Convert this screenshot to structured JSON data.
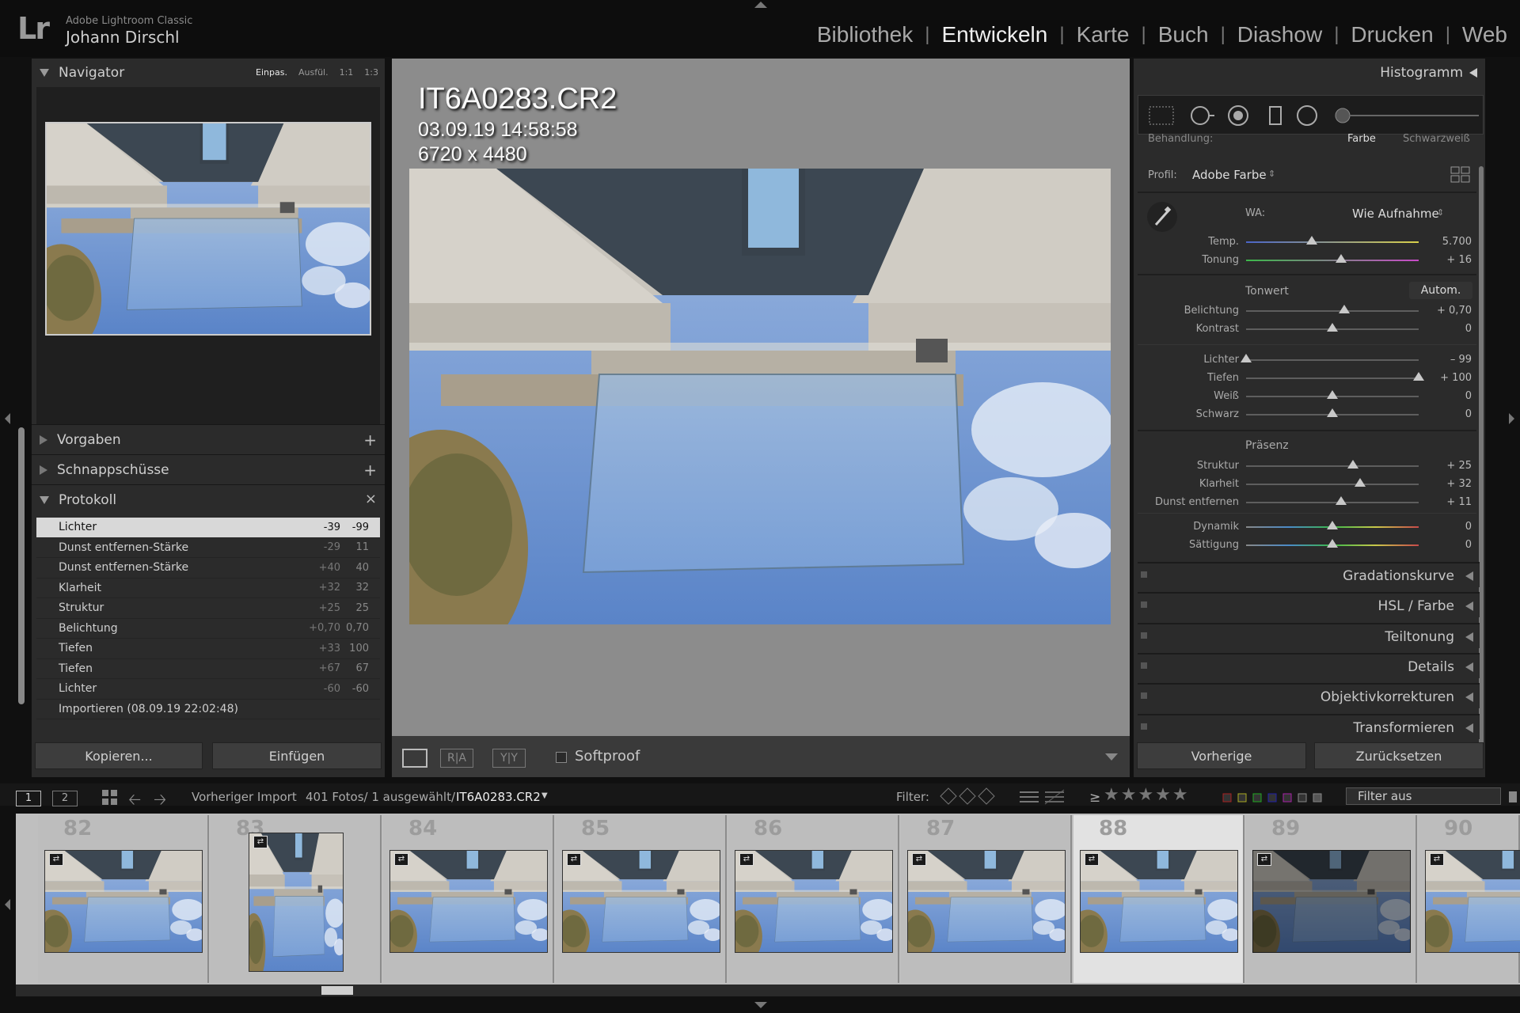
{
  "app": {
    "logo": "Lr",
    "name": "Adobe Lightroom Classic",
    "user": "Johann Dirschl"
  },
  "modules": [
    {
      "label": "Bibliothek",
      "active": false
    },
    {
      "label": "Entwickeln",
      "active": true
    },
    {
      "label": "Karte",
      "active": false
    },
    {
      "label": "Buch",
      "active": false
    },
    {
      "label": "Diashow",
      "active": false
    },
    {
      "label": "Drucken",
      "active": false
    },
    {
      "label": "Web",
      "active": false
    }
  ],
  "left_panel": {
    "navigator": {
      "title": "Navigator",
      "zoom_options": [
        "Einpas.",
        "Ausfül.",
        "1:1",
        "1:3"
      ],
      "zoom_selected": "Einpas."
    },
    "presets": {
      "title": "Vorgaben",
      "action": "+"
    },
    "snapshots": {
      "title": "Schnappschüsse",
      "action": "+"
    },
    "history": {
      "title": "Protokoll",
      "action": "×",
      "rows": [
        {
          "label": "Lichter",
          "delta": "-39",
          "value": "-99",
          "selected": true
        },
        {
          "label": "Dunst entfernen-Stärke",
          "delta": "-29",
          "value": "11"
        },
        {
          "label": "Dunst entfernen-Stärke",
          "delta": "+40",
          "value": "40"
        },
        {
          "label": "Klarheit",
          "delta": "+32",
          "value": "32"
        },
        {
          "label": "Struktur",
          "delta": "+25",
          "value": "25"
        },
        {
          "label": "Belichtung",
          "delta": "+0,70",
          "value": "0,70"
        },
        {
          "label": "Tiefen",
          "delta": "+33",
          "value": "100"
        },
        {
          "label": "Tiefen",
          "delta": "+67",
          "value": "67"
        },
        {
          "label": "Lichter",
          "delta": "-60",
          "value": "-60"
        },
        {
          "label": "Importieren (08.09.19 22:02:48)",
          "delta": "",
          "value": ""
        }
      ]
    },
    "copy_button": "Kopieren...",
    "paste_button": "Einfügen"
  },
  "center": {
    "filename": "IT6A0283.CR2",
    "datetime": "03.09.19 14:58:58",
    "dimensions": "6720 x 4480",
    "toolbar": {
      "ra_label": "R|A",
      "yy_label": "Y|Y",
      "softproof_label": "Softproof"
    }
  },
  "right_panel": {
    "histogram_title": "Histogramm",
    "treatment": {
      "label": "Behandlung:",
      "color": "Farbe",
      "bw": "Schwarzweiß"
    },
    "profile": {
      "label": "Profil:",
      "value": "Adobe Farbe"
    },
    "wb": {
      "label": "WA:",
      "value": "Wie Aufnahme"
    },
    "sliders_wb": [
      {
        "label": "Temp.",
        "value": "5.700",
        "pos": 0.38
      },
      {
        "label": "Tonung",
        "value": "+ 16",
        "pos": 0.55
      }
    ],
    "tone_title": "Tonwert",
    "auto_label": "Autom.",
    "sliders_tone1": [
      {
        "label": "Belichtung",
        "value": "+ 0,70",
        "pos": 0.57
      },
      {
        "label": "Kontrast",
        "value": "0",
        "pos": 0.5
      }
    ],
    "sliders_tone2": [
      {
        "label": "Lichter",
        "value": "– 99",
        "pos": 0.0
      },
      {
        "label": "Tiefen",
        "value": "+ 100",
        "pos": 1.0
      },
      {
        "label": "Weiß",
        "value": "0",
        "pos": 0.5
      },
      {
        "label": "Schwarz",
        "value": "0",
        "pos": 0.5
      }
    ],
    "presence_title": "Präsenz",
    "sliders_presence": [
      {
        "label": "Struktur",
        "value": "+ 25",
        "pos": 0.62
      },
      {
        "label": "Klarheit",
        "value": "+ 32",
        "pos": 0.66
      },
      {
        "label": "Dunst entfernen",
        "value": "+ 11",
        "pos": 0.55
      }
    ],
    "sliders_color": [
      {
        "label": "Dynamik",
        "value": "0",
        "pos": 0.5
      },
      {
        "label": "Sättigung",
        "value": "0",
        "pos": 0.5
      }
    ],
    "sections": [
      {
        "label": "Gradationskurve"
      },
      {
        "label": "HSL / Farbe"
      },
      {
        "label": "Teiltonung"
      },
      {
        "label": "Details"
      },
      {
        "label": "Objektivkorrekturen"
      },
      {
        "label": "Transformieren"
      }
    ],
    "prev_button": "Vorherige",
    "reset_button": "Zurücksetzen"
  },
  "filmbar": {
    "screen1": "1",
    "screen2": "2",
    "source": "Vorheriger Import",
    "count": "401 Fotos/ 1 ausgewählt/",
    "current": "IT6A0283.CR2",
    "filter_label": "Filter:",
    "rating_op": "≥",
    "stars": "★★★★★",
    "filter_value": "Filter aus"
  },
  "filmstrip": [
    {
      "num": "82"
    },
    {
      "num": "83"
    },
    {
      "num": "84"
    },
    {
      "num": "85"
    },
    {
      "num": "86"
    },
    {
      "num": "87"
    },
    {
      "num": "88",
      "selected": true
    },
    {
      "num": "89"
    },
    {
      "num": "90"
    }
  ],
  "colors": {
    "accent": "#d8d8d8",
    "panel": "#2b2b2b",
    "center_bg": "#8c8c8c",
    "sky": "#7ea3d8"
  }
}
